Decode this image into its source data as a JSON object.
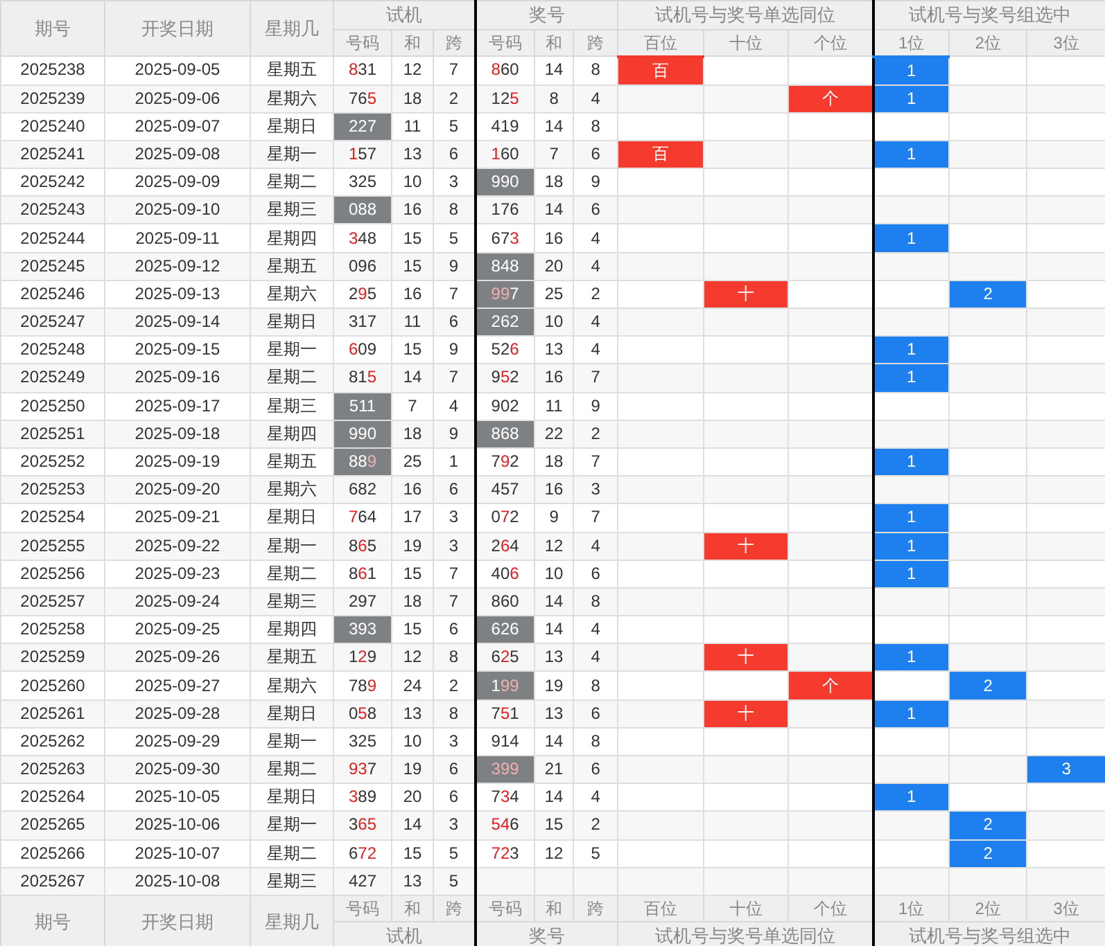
{
  "header": {
    "columns": [
      "期号",
      "开奖日期",
      "星期几"
    ],
    "groups": [
      "试机",
      "奖号",
      "试机号与奖号单选同位",
      "试机号与奖号组选中"
    ],
    "sub": [
      "号码",
      "和",
      "跨",
      "号码",
      "和",
      "跨",
      "百位",
      "十位",
      "个位",
      "1位",
      "2位",
      "3位"
    ]
  },
  "rows": [
    {
      "issue": "2025238",
      "date": "2025-09-05",
      "weekday": "星期五",
      "trial": {
        "number": "831",
        "red": [
          true,
          false,
          false
        ],
        "shaded": false,
        "sum": "12",
        "span": "7"
      },
      "draw": {
        "number": "860",
        "red": [
          true,
          false,
          false
        ],
        "shaded": false,
        "sum": "14",
        "span": "8"
      },
      "single": {
        "kind": "hundreds",
        "text": "百"
      },
      "group": {
        "kind": "first",
        "text": "1"
      }
    },
    {
      "issue": "2025239",
      "date": "2025-09-06",
      "weekday": "星期六",
      "trial": {
        "number": "765",
        "red": [
          false,
          false,
          true
        ],
        "shaded": false,
        "sum": "18",
        "span": "2"
      },
      "draw": {
        "number": "125",
        "red": [
          false,
          false,
          true
        ],
        "shaded": false,
        "sum": "8",
        "span": "4"
      },
      "single": {
        "kind": "units",
        "text": "个"
      },
      "group": {
        "kind": "first",
        "text": "1"
      }
    },
    {
      "issue": "2025240",
      "date": "2025-09-07",
      "weekday": "星期日",
      "trial": {
        "number": "227",
        "red": [
          false,
          false,
          false
        ],
        "shaded": true,
        "sum": "11",
        "span": "5"
      },
      "draw": {
        "number": "419",
        "red": [
          false,
          false,
          false
        ],
        "shaded": false,
        "sum": "14",
        "span": "8"
      }
    },
    {
      "issue": "2025241",
      "date": "2025-09-08",
      "weekday": "星期一",
      "trial": {
        "number": "157",
        "red": [
          true,
          false,
          false
        ],
        "shaded": false,
        "sum": "13",
        "span": "6"
      },
      "draw": {
        "number": "160",
        "red": [
          true,
          false,
          false
        ],
        "shaded": false,
        "sum": "7",
        "span": "6"
      },
      "single": {
        "kind": "hundreds",
        "text": "百"
      },
      "group": {
        "kind": "first",
        "text": "1"
      }
    },
    {
      "issue": "2025242",
      "date": "2025-09-09",
      "weekday": "星期二",
      "trial": {
        "number": "325",
        "red": [
          false,
          false,
          false
        ],
        "shaded": false,
        "sum": "10",
        "span": "3"
      },
      "draw": {
        "number": "990",
        "red": [
          false,
          false,
          false
        ],
        "shaded": true,
        "sum": "18",
        "span": "9"
      }
    },
    {
      "issue": "2025243",
      "date": "2025-09-10",
      "weekday": "星期三",
      "trial": {
        "number": "088",
        "red": [
          false,
          false,
          false
        ],
        "shaded": true,
        "sum": "16",
        "span": "8"
      },
      "draw": {
        "number": "176",
        "red": [
          false,
          false,
          false
        ],
        "shaded": false,
        "sum": "14",
        "span": "6"
      }
    },
    {
      "issue": "2025244",
      "date": "2025-09-11",
      "weekday": "星期四",
      "trial": {
        "number": "348",
        "red": [
          true,
          false,
          false
        ],
        "shaded": false,
        "sum": "15",
        "span": "5"
      },
      "draw": {
        "number": "673",
        "red": [
          false,
          false,
          true
        ],
        "shaded": false,
        "sum": "16",
        "span": "4"
      },
      "group": {
        "kind": "first",
        "text": "1"
      }
    },
    {
      "issue": "2025245",
      "date": "2025-09-12",
      "weekday": "星期五",
      "trial": {
        "number": "096",
        "red": [
          false,
          false,
          false
        ],
        "shaded": false,
        "sum": "15",
        "span": "9"
      },
      "draw": {
        "number": "848",
        "red": [
          false,
          false,
          false
        ],
        "shaded": true,
        "sum": "20",
        "span": "4"
      }
    },
    {
      "issue": "2025246",
      "date": "2025-09-13",
      "weekday": "星期六",
      "trial": {
        "number": "295",
        "red": [
          false,
          true,
          false
        ],
        "shaded": false,
        "sum": "16",
        "span": "7"
      },
      "draw": {
        "number": "997",
        "red": [
          true,
          true,
          false
        ],
        "shaded": true,
        "sum": "25",
        "span": "2"
      },
      "single": {
        "kind": "tens",
        "text": "十"
      },
      "group": {
        "kind": "second",
        "text": "2"
      }
    },
    {
      "issue": "2025247",
      "date": "2025-09-14",
      "weekday": "星期日",
      "trial": {
        "number": "317",
        "red": [
          false,
          false,
          false
        ],
        "shaded": false,
        "sum": "11",
        "span": "6"
      },
      "draw": {
        "number": "262",
        "red": [
          false,
          false,
          false
        ],
        "shaded": true,
        "sum": "10",
        "span": "4"
      }
    },
    {
      "issue": "2025248",
      "date": "2025-09-15",
      "weekday": "星期一",
      "trial": {
        "number": "609",
        "red": [
          true,
          false,
          false
        ],
        "shaded": false,
        "sum": "15",
        "span": "9"
      },
      "draw": {
        "number": "526",
        "red": [
          false,
          false,
          true
        ],
        "shaded": false,
        "sum": "13",
        "span": "4"
      },
      "group": {
        "kind": "first",
        "text": "1"
      }
    },
    {
      "issue": "2025249",
      "date": "2025-09-16",
      "weekday": "星期二",
      "trial": {
        "number": "815",
        "red": [
          false,
          false,
          true
        ],
        "shaded": false,
        "sum": "14",
        "span": "7"
      },
      "draw": {
        "number": "952",
        "red": [
          false,
          true,
          false
        ],
        "shaded": false,
        "sum": "16",
        "span": "7"
      },
      "group": {
        "kind": "first",
        "text": "1"
      }
    },
    {
      "issue": "2025250",
      "date": "2025-09-17",
      "weekday": "星期三",
      "trial": {
        "number": "511",
        "red": [
          false,
          false,
          false
        ],
        "shaded": true,
        "sum": "7",
        "span": "4"
      },
      "draw": {
        "number": "902",
        "red": [
          false,
          false,
          false
        ],
        "shaded": false,
        "sum": "11",
        "span": "9"
      }
    },
    {
      "issue": "2025251",
      "date": "2025-09-18",
      "weekday": "星期四",
      "trial": {
        "number": "990",
        "red": [
          false,
          false,
          false
        ],
        "shaded": true,
        "sum": "18",
        "span": "9"
      },
      "draw": {
        "number": "868",
        "red": [
          false,
          false,
          false
        ],
        "shaded": true,
        "sum": "22",
        "span": "2"
      }
    },
    {
      "issue": "2025252",
      "date": "2025-09-19",
      "weekday": "星期五",
      "trial": {
        "number": "889",
        "red": [
          false,
          false,
          true
        ],
        "shaded": true,
        "sum": "25",
        "span": "1"
      },
      "draw": {
        "number": "792",
        "red": [
          false,
          true,
          false
        ],
        "shaded": false,
        "sum": "18",
        "span": "7"
      },
      "group": {
        "kind": "first",
        "text": "1"
      }
    },
    {
      "issue": "2025253",
      "date": "2025-09-20",
      "weekday": "星期六",
      "trial": {
        "number": "682",
        "red": [
          false,
          false,
          false
        ],
        "shaded": false,
        "sum": "16",
        "span": "6"
      },
      "draw": {
        "number": "457",
        "red": [
          false,
          false,
          false
        ],
        "shaded": false,
        "sum": "16",
        "span": "3"
      }
    },
    {
      "issue": "2025254",
      "date": "2025-09-21",
      "weekday": "星期日",
      "trial": {
        "number": "764",
        "red": [
          true,
          false,
          false
        ],
        "shaded": false,
        "sum": "17",
        "span": "3"
      },
      "draw": {
        "number": "072",
        "red": [
          false,
          true,
          false
        ],
        "shaded": false,
        "sum": "9",
        "span": "7"
      },
      "group": {
        "kind": "first",
        "text": "1"
      }
    },
    {
      "issue": "2025255",
      "date": "2025-09-22",
      "weekday": "星期一",
      "trial": {
        "number": "865",
        "red": [
          false,
          true,
          false
        ],
        "shaded": false,
        "sum": "19",
        "span": "3"
      },
      "draw": {
        "number": "264",
        "red": [
          false,
          true,
          false
        ],
        "shaded": false,
        "sum": "12",
        "span": "4"
      },
      "single": {
        "kind": "tens",
        "text": "十"
      },
      "group": {
        "kind": "first",
        "text": "1"
      }
    },
    {
      "issue": "2025256",
      "date": "2025-09-23",
      "weekday": "星期二",
      "trial": {
        "number": "861",
        "red": [
          false,
          true,
          false
        ],
        "shaded": false,
        "sum": "15",
        "span": "7"
      },
      "draw": {
        "number": "406",
        "red": [
          false,
          false,
          true
        ],
        "shaded": false,
        "sum": "10",
        "span": "6"
      },
      "group": {
        "kind": "first",
        "text": "1"
      }
    },
    {
      "issue": "2025257",
      "date": "2025-09-24",
      "weekday": "星期三",
      "trial": {
        "number": "297",
        "red": [
          false,
          false,
          false
        ],
        "shaded": false,
        "sum": "18",
        "span": "7"
      },
      "draw": {
        "number": "860",
        "red": [
          false,
          false,
          false
        ],
        "shaded": false,
        "sum": "14",
        "span": "8"
      }
    },
    {
      "issue": "2025258",
      "date": "2025-09-25",
      "weekday": "星期四",
      "trial": {
        "number": "393",
        "red": [
          false,
          false,
          false
        ],
        "shaded": true,
        "sum": "15",
        "span": "6"
      },
      "draw": {
        "number": "626",
        "red": [
          false,
          false,
          false
        ],
        "shaded": true,
        "sum": "14",
        "span": "4"
      }
    },
    {
      "issue": "2025259",
      "date": "2025-09-26",
      "weekday": "星期五",
      "trial": {
        "number": "129",
        "red": [
          false,
          true,
          false
        ],
        "shaded": false,
        "sum": "12",
        "span": "8"
      },
      "draw": {
        "number": "625",
        "red": [
          false,
          true,
          false
        ],
        "shaded": false,
        "sum": "13",
        "span": "4"
      },
      "single": {
        "kind": "tens",
        "text": "十"
      },
      "group": {
        "kind": "first",
        "text": "1"
      }
    },
    {
      "issue": "2025260",
      "date": "2025-09-27",
      "weekday": "星期六",
      "trial": {
        "number": "789",
        "red": [
          false,
          false,
          true
        ],
        "shaded": false,
        "sum": "24",
        "span": "2"
      },
      "draw": {
        "number": "199",
        "red": [
          false,
          true,
          true
        ],
        "shaded": true,
        "sum": "19",
        "span": "8"
      },
      "single": {
        "kind": "units",
        "text": "个"
      },
      "group": {
        "kind": "second",
        "text": "2"
      }
    },
    {
      "issue": "2025261",
      "date": "2025-09-28",
      "weekday": "星期日",
      "trial": {
        "number": "058",
        "red": [
          false,
          true,
          false
        ],
        "shaded": false,
        "sum": "13",
        "span": "8"
      },
      "draw": {
        "number": "751",
        "red": [
          false,
          true,
          false
        ],
        "shaded": false,
        "sum": "13",
        "span": "6"
      },
      "single": {
        "kind": "tens",
        "text": "十"
      },
      "group": {
        "kind": "first",
        "text": "1"
      }
    },
    {
      "issue": "2025262",
      "date": "2025-09-29",
      "weekday": "星期一",
      "trial": {
        "number": "325",
        "red": [
          false,
          false,
          false
        ],
        "shaded": false,
        "sum": "10",
        "span": "3"
      },
      "draw": {
        "number": "914",
        "red": [
          false,
          false,
          false
        ],
        "shaded": false,
        "sum": "14",
        "span": "8"
      }
    },
    {
      "issue": "2025263",
      "date": "2025-09-30",
      "weekday": "星期二",
      "trial": {
        "number": "937",
        "red": [
          true,
          true,
          false
        ],
        "shaded": false,
        "sum": "19",
        "span": "6"
      },
      "draw": {
        "number": "399",
        "red": [
          true,
          true,
          true
        ],
        "shaded": true,
        "sum": "21",
        "span": "6"
      },
      "group": {
        "kind": "third",
        "text": "3"
      }
    },
    {
      "issue": "2025264",
      "date": "2025-10-05",
      "weekday": "星期日",
      "trial": {
        "number": "389",
        "red": [
          true,
          false,
          false
        ],
        "shaded": false,
        "sum": "20",
        "span": "6"
      },
      "draw": {
        "number": "734",
        "red": [
          false,
          true,
          false
        ],
        "shaded": false,
        "sum": "14",
        "span": "4"
      },
      "group": {
        "kind": "first",
        "text": "1"
      }
    },
    {
      "issue": "2025265",
      "date": "2025-10-06",
      "weekday": "星期一",
      "trial": {
        "number": "365",
        "red": [
          false,
          true,
          true
        ],
        "shaded": false,
        "sum": "14",
        "span": "3"
      },
      "draw": {
        "number": "546",
        "red": [
          true,
          true,
          false
        ],
        "shaded": false,
        "sum": "15",
        "span": "2"
      },
      "group": {
        "kind": "second",
        "text": "2"
      }
    },
    {
      "issue": "2025266",
      "date": "2025-10-07",
      "weekday": "星期二",
      "trial": {
        "number": "672",
        "red": [
          false,
          true,
          true
        ],
        "shaded": false,
        "sum": "15",
        "span": "5"
      },
      "draw": {
        "number": "723",
        "red": [
          true,
          true,
          false
        ],
        "shaded": false,
        "sum": "12",
        "span": "5"
      },
      "group": {
        "kind": "second",
        "text": "2"
      }
    },
    {
      "issue": "2025267",
      "date": "2025-10-08",
      "weekday": "星期三",
      "trial": {
        "number": "427",
        "red": [
          false,
          false,
          false
        ],
        "shaded": false,
        "sum": "13",
        "span": "5"
      }
    }
  ],
  "footer": {
    "columns": [
      "期号",
      "开奖日期",
      "星期几"
    ],
    "sub": [
      "号码",
      "和",
      "跨",
      "号码",
      "和",
      "跨",
      "百位",
      "十位",
      "个位",
      "1位",
      "2位",
      "3位"
    ],
    "groups": [
      "试机",
      "奖号",
      "试机号与奖号单选同位",
      "试机号与奖号组选中"
    ]
  }
}
